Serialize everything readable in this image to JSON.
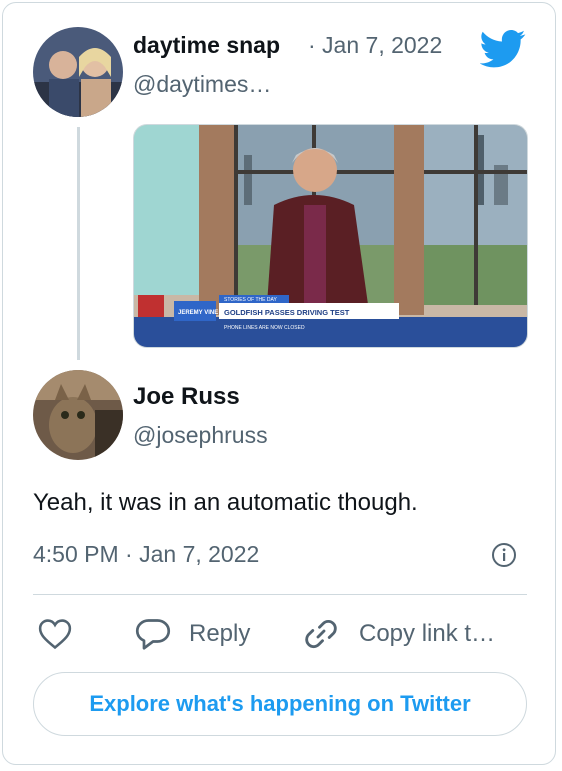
{
  "parent_tweet": {
    "display_name": "daytime snap",
    "date": "· Jan 7, 2022",
    "handle": "@daytimes…",
    "avatar_icon": "avatar-photo-two-people",
    "media_image": {
      "description_icon": "tv-show-still-icon",
      "banner_text": "GOLDFISH PASSES DRIVING TEST",
      "banner_small_text": "STORIES OF THE DAY",
      "banner_sub_text": "PHONE LINES ARE NOW CLOSED",
      "logo_text": "JEREMY VINE"
    }
  },
  "reply_tweet": {
    "display_name": "Joe Russ",
    "handle": "@josephruss",
    "text": "Yeah, it was in an automatic though.",
    "timestamp": "4:50 PM · Jan 7, 2022",
    "avatar_icon": "avatar-photo-cat"
  },
  "actions": {
    "like_icon": "heart-icon",
    "reply_label": "Reply",
    "reply_icon": "speech-bubble-icon",
    "copy_label": "Copy link t…",
    "copy_icon": "link-icon"
  },
  "explore_button": {
    "label": "Explore what's happening on Twitter"
  },
  "colors": {
    "accent": "#1d9bf0",
    "secondary_text": "#536471",
    "border": "#cfd9de",
    "primary_text": "#0f1419"
  }
}
